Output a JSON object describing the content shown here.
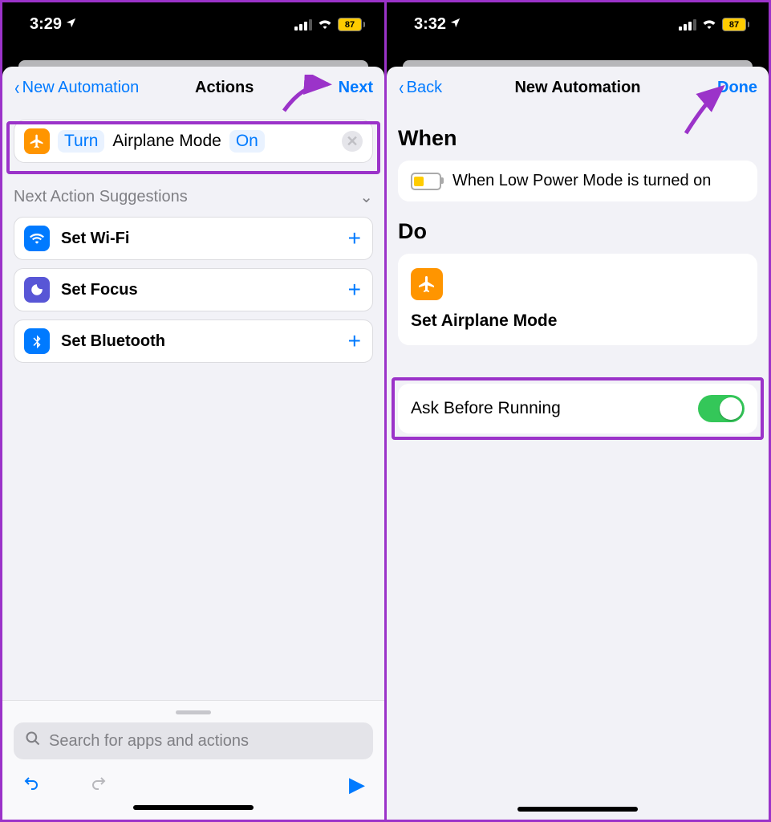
{
  "left": {
    "status": {
      "time": "3:29",
      "battery": "87"
    },
    "nav": {
      "back": "New Automation",
      "title": "Actions",
      "right": "Next"
    },
    "action": {
      "tokens": {
        "turn": "Turn",
        "subject": "Airplane Mode",
        "state": "On"
      }
    },
    "suggestions": {
      "header": "Next Action Suggestions",
      "items": [
        {
          "label": "Set Wi-Fi",
          "iconColor": "blue"
        },
        {
          "label": "Set Focus",
          "iconColor": "indigo"
        },
        {
          "label": "Set Bluetooth",
          "iconColor": "blue"
        }
      ]
    },
    "search_placeholder": "Search for apps and actions"
  },
  "right": {
    "status": {
      "time": "3:32",
      "battery": "87"
    },
    "nav": {
      "back": "Back",
      "title": "New Automation",
      "right": "Done"
    },
    "when": {
      "title": "When",
      "text": "When Low Power Mode is turned on"
    },
    "do": {
      "title": "Do",
      "label": "Set Airplane Mode"
    },
    "ask": {
      "label": "Ask Before Running",
      "on": true
    }
  }
}
